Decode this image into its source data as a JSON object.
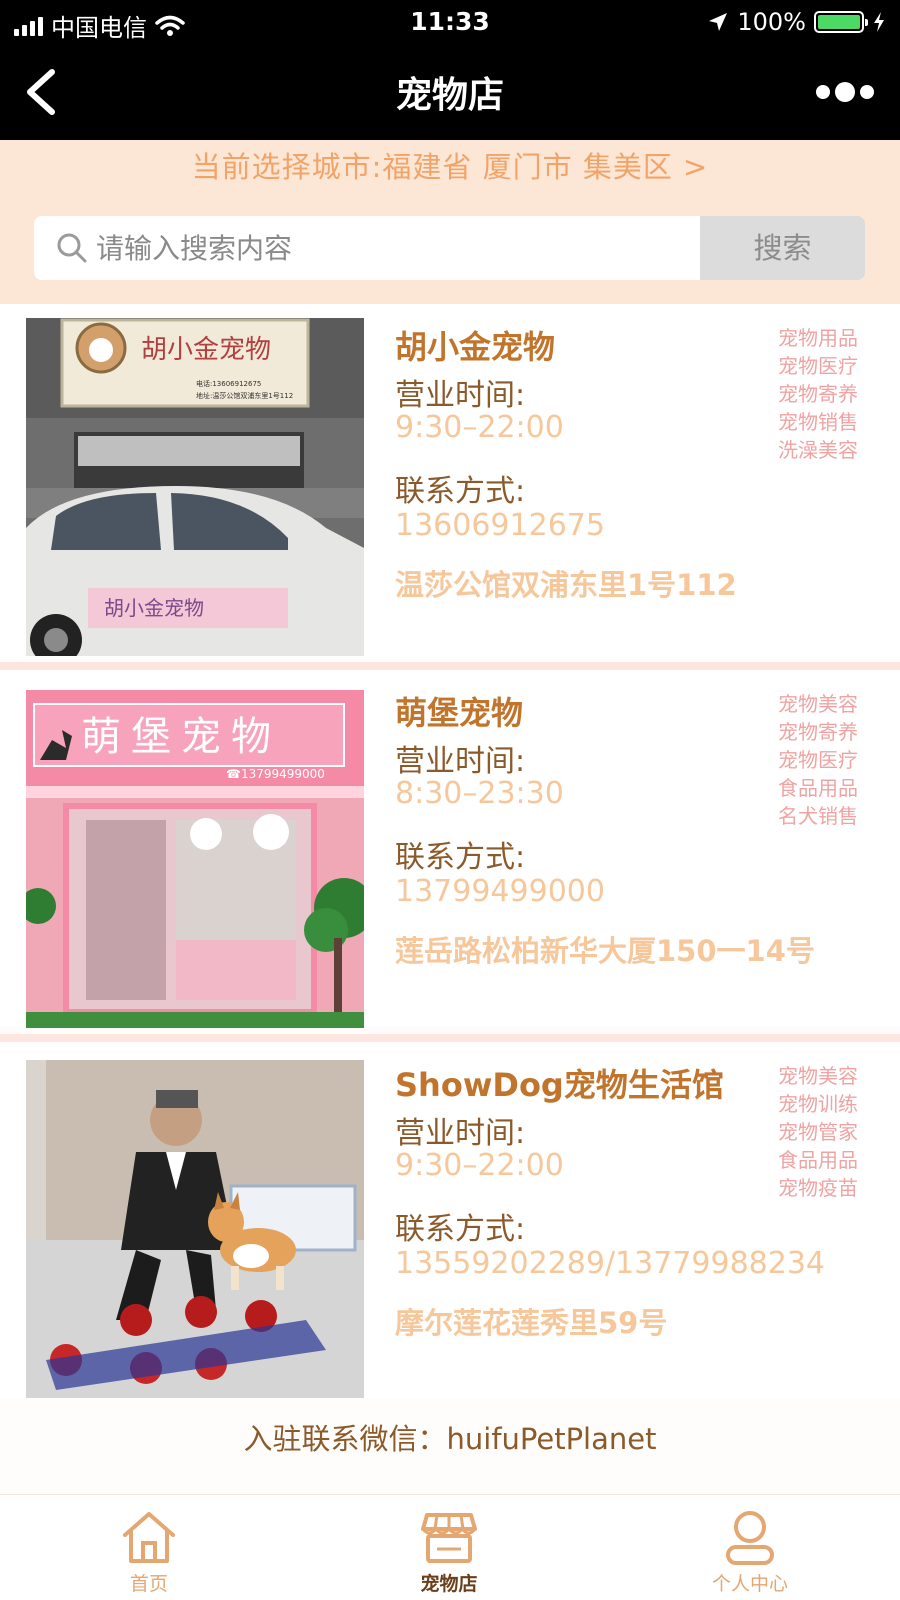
{
  "status_bar": {
    "carrier": "中国电信",
    "time": "11:33",
    "battery_percent": "100%",
    "battery_level": 1.0
  },
  "nav": {
    "title": "宠物店",
    "back_icon": "chevron-left-icon",
    "more_icon": "more-dots-icon"
  },
  "city": {
    "text": "当前选择城市:福建省 厦门市 集美区 >"
  },
  "search": {
    "placeholder": "请输入搜索内容",
    "value": "",
    "button_label": "搜索"
  },
  "shops": [
    {
      "name": "胡小金宠物",
      "hours_label": "营业时间:",
      "hours": "9:30–22:00",
      "contact_label": "联系方式:",
      "phone": "13606912675",
      "address": "温莎公馆双浦东里1号112",
      "services": [
        "宠物用品",
        "宠物医疗",
        "宠物寄养",
        "宠物销售",
        "洗澡美容"
      ],
      "photo_sign": "胡小金宠物",
      "photo_sign_phone": "电话:13606912675",
      "photo_sign_addr": "地址:温莎公馆双浦东里1号112"
    },
    {
      "name": "萌堡宠物",
      "hours_label": "营业时间:",
      "hours": "8:30–23:30",
      "contact_label": "联系方式:",
      "phone": "13799499000",
      "address": "莲岳路松柏新华大厦150一14号",
      "services": [
        "宠物美容",
        "宠物寄养",
        "宠物医疗",
        "食品用品",
        "名犬销售"
      ],
      "photo_sign": "萌堡宠物",
      "photo_sign_phone": "☎13799499000"
    },
    {
      "name": "ShowDog宠物生活馆",
      "hours_label": "营业时间:",
      "hours": "9:30–22:00",
      "contact_label": "联系方式:",
      "phone": "13559202289/13779988234",
      "address": "摩尔莲花莲秀里59号",
      "services": [
        "宠物美容",
        "宠物训练",
        "宠物管家",
        "食品用品",
        "宠物疫苗"
      ]
    }
  ],
  "footer_note": "入驻联系微信：huifuPetPlanet",
  "tabs": [
    {
      "label": "首页",
      "icon": "home-icon"
    },
    {
      "label": "宠物店",
      "icon": "shop-icon"
    },
    {
      "label": "个人中心",
      "icon": "user-icon"
    }
  ],
  "colors": {
    "accent": "#f2a468",
    "title_brown": "#c0742c",
    "value_peach": "#f6c79a",
    "service_pink": "#f0a3a3",
    "city_bg": "#fce7d6"
  }
}
